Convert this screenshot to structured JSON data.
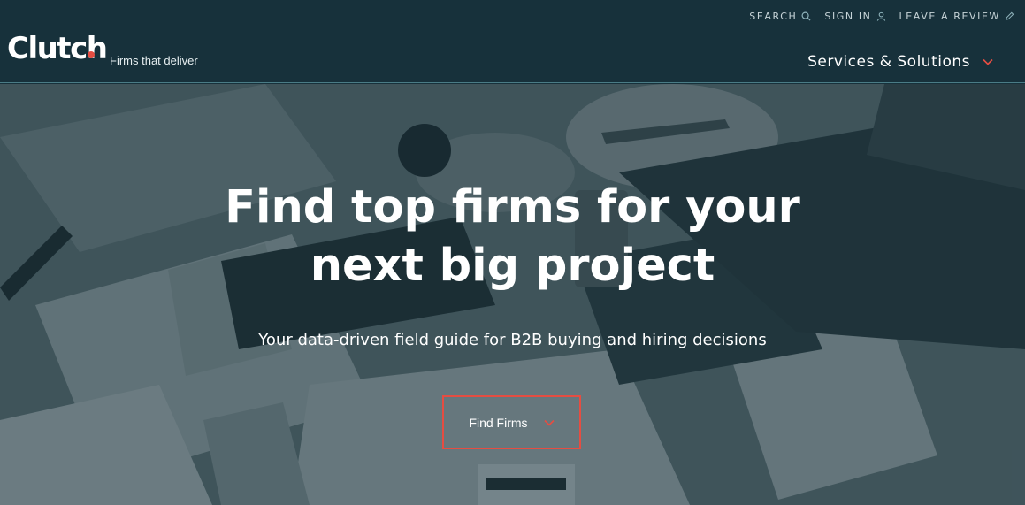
{
  "header": {
    "utility": {
      "search_label": "SEARCH",
      "sign_in_label": "SIGN IN",
      "review_label": "LEAVE A REVIEW"
    },
    "logo_text": "Clutch",
    "tagline": "Firms that deliver",
    "services_label": "Services & Solutions"
  },
  "hero": {
    "headline_line1": "Find top firms for your",
    "headline_line2": "next big project",
    "subhead": "Your data-driven field guide for B2B buying and hiring decisions",
    "cta_label": "Find Firms"
  },
  "colors": {
    "header_bg": "#17313b",
    "accent": "#e54d42",
    "text": "#ffffff"
  }
}
